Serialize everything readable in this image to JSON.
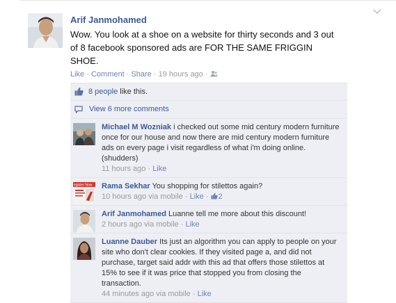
{
  "post": {
    "author": "Arif Janmohamed",
    "message": "Wow. You look at a shoe on a website for thirty seconds and 3 out of 8 facebook sponsored ads are FOR THE SAME FRIGGIN SHOE.",
    "actions": {
      "like": "Like",
      "comment": "Comment",
      "share": "Share",
      "sep": " · ",
      "time": "19 hours ago"
    },
    "likes": {
      "count_link": "8 people",
      "suffix": " like this."
    },
    "view_more": "View 6 more comments",
    "chevron_icon": "chevron-down-icon",
    "audience_icon": "friends-icon"
  },
  "comments": [
    {
      "author": "Michael M Wozniak",
      "text": "i checked out some mid century modern furniture once for our house and now there are mid century modern furniture ads on every page i visit regardless of what i'm doing online. (shudders)",
      "time": "11 hours ago",
      "like": "Like"
    },
    {
      "author": "Rama Sekhar",
      "text": "You shopping for stilettos again?",
      "time": "10 hours ago via mobile",
      "like": "Like",
      "like_count": "2",
      "avatar_text": "egister Now"
    },
    {
      "author": "Arif Janmohamed",
      "text": "Luanne tell me more about this discount!",
      "time": "2 hours ago via mobile",
      "like": "Like"
    },
    {
      "author": "Luanne Dauber",
      "text": "Its just an algorithm you can apply to people on your site who don't clear cookies. If they visited page a, and did not purchase, target said addr with this ad that offers those stilettos at 15% to see if it was price that stopped you from closing the transaction.",
      "time": "44 minutes ago via mobile",
      "like": "Like"
    }
  ],
  "colors": {
    "link": "#3b5998",
    "feed_bg": "#edeff4",
    "meta": "#999999"
  }
}
